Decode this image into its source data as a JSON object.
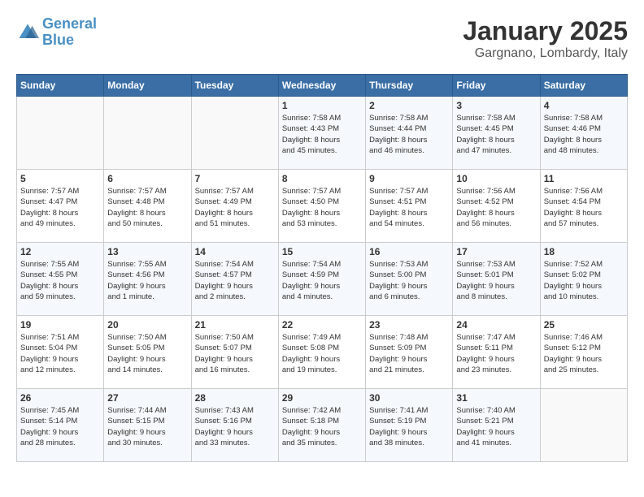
{
  "header": {
    "logo_line1": "General",
    "logo_line2": "Blue",
    "month": "January 2025",
    "location": "Gargnano, Lombardy, Italy"
  },
  "weekdays": [
    "Sunday",
    "Monday",
    "Tuesday",
    "Wednesday",
    "Thursday",
    "Friday",
    "Saturday"
  ],
  "weeks": [
    [
      {
        "day": "",
        "info": ""
      },
      {
        "day": "",
        "info": ""
      },
      {
        "day": "",
        "info": ""
      },
      {
        "day": "1",
        "info": "Sunrise: 7:58 AM\nSunset: 4:43 PM\nDaylight: 8 hours\nand 45 minutes."
      },
      {
        "day": "2",
        "info": "Sunrise: 7:58 AM\nSunset: 4:44 PM\nDaylight: 8 hours\nand 46 minutes."
      },
      {
        "day": "3",
        "info": "Sunrise: 7:58 AM\nSunset: 4:45 PM\nDaylight: 8 hours\nand 47 minutes."
      },
      {
        "day": "4",
        "info": "Sunrise: 7:58 AM\nSunset: 4:46 PM\nDaylight: 8 hours\nand 48 minutes."
      }
    ],
    [
      {
        "day": "5",
        "info": "Sunrise: 7:57 AM\nSunset: 4:47 PM\nDaylight: 8 hours\nand 49 minutes."
      },
      {
        "day": "6",
        "info": "Sunrise: 7:57 AM\nSunset: 4:48 PM\nDaylight: 8 hours\nand 50 minutes."
      },
      {
        "day": "7",
        "info": "Sunrise: 7:57 AM\nSunset: 4:49 PM\nDaylight: 8 hours\nand 51 minutes."
      },
      {
        "day": "8",
        "info": "Sunrise: 7:57 AM\nSunset: 4:50 PM\nDaylight: 8 hours\nand 53 minutes."
      },
      {
        "day": "9",
        "info": "Sunrise: 7:57 AM\nSunset: 4:51 PM\nDaylight: 8 hours\nand 54 minutes."
      },
      {
        "day": "10",
        "info": "Sunrise: 7:56 AM\nSunset: 4:52 PM\nDaylight: 8 hours\nand 56 minutes."
      },
      {
        "day": "11",
        "info": "Sunrise: 7:56 AM\nSunset: 4:54 PM\nDaylight: 8 hours\nand 57 minutes."
      }
    ],
    [
      {
        "day": "12",
        "info": "Sunrise: 7:55 AM\nSunset: 4:55 PM\nDaylight: 8 hours\nand 59 minutes."
      },
      {
        "day": "13",
        "info": "Sunrise: 7:55 AM\nSunset: 4:56 PM\nDaylight: 9 hours\nand 1 minute."
      },
      {
        "day": "14",
        "info": "Sunrise: 7:54 AM\nSunset: 4:57 PM\nDaylight: 9 hours\nand 2 minutes."
      },
      {
        "day": "15",
        "info": "Sunrise: 7:54 AM\nSunset: 4:59 PM\nDaylight: 9 hours\nand 4 minutes."
      },
      {
        "day": "16",
        "info": "Sunrise: 7:53 AM\nSunset: 5:00 PM\nDaylight: 9 hours\nand 6 minutes."
      },
      {
        "day": "17",
        "info": "Sunrise: 7:53 AM\nSunset: 5:01 PM\nDaylight: 9 hours\nand 8 minutes."
      },
      {
        "day": "18",
        "info": "Sunrise: 7:52 AM\nSunset: 5:02 PM\nDaylight: 9 hours\nand 10 minutes."
      }
    ],
    [
      {
        "day": "19",
        "info": "Sunrise: 7:51 AM\nSunset: 5:04 PM\nDaylight: 9 hours\nand 12 minutes."
      },
      {
        "day": "20",
        "info": "Sunrise: 7:50 AM\nSunset: 5:05 PM\nDaylight: 9 hours\nand 14 minutes."
      },
      {
        "day": "21",
        "info": "Sunrise: 7:50 AM\nSunset: 5:07 PM\nDaylight: 9 hours\nand 16 minutes."
      },
      {
        "day": "22",
        "info": "Sunrise: 7:49 AM\nSunset: 5:08 PM\nDaylight: 9 hours\nand 19 minutes."
      },
      {
        "day": "23",
        "info": "Sunrise: 7:48 AM\nSunset: 5:09 PM\nDaylight: 9 hours\nand 21 minutes."
      },
      {
        "day": "24",
        "info": "Sunrise: 7:47 AM\nSunset: 5:11 PM\nDaylight: 9 hours\nand 23 minutes."
      },
      {
        "day": "25",
        "info": "Sunrise: 7:46 AM\nSunset: 5:12 PM\nDaylight: 9 hours\nand 25 minutes."
      }
    ],
    [
      {
        "day": "26",
        "info": "Sunrise: 7:45 AM\nSunset: 5:14 PM\nDaylight: 9 hours\nand 28 minutes."
      },
      {
        "day": "27",
        "info": "Sunrise: 7:44 AM\nSunset: 5:15 PM\nDaylight: 9 hours\nand 30 minutes."
      },
      {
        "day": "28",
        "info": "Sunrise: 7:43 AM\nSunset: 5:16 PM\nDaylight: 9 hours\nand 33 minutes."
      },
      {
        "day": "29",
        "info": "Sunrise: 7:42 AM\nSunset: 5:18 PM\nDaylight: 9 hours\nand 35 minutes."
      },
      {
        "day": "30",
        "info": "Sunrise: 7:41 AM\nSunset: 5:19 PM\nDaylight: 9 hours\nand 38 minutes."
      },
      {
        "day": "31",
        "info": "Sunrise: 7:40 AM\nSunset: 5:21 PM\nDaylight: 9 hours\nand 41 minutes."
      },
      {
        "day": "",
        "info": ""
      }
    ]
  ]
}
